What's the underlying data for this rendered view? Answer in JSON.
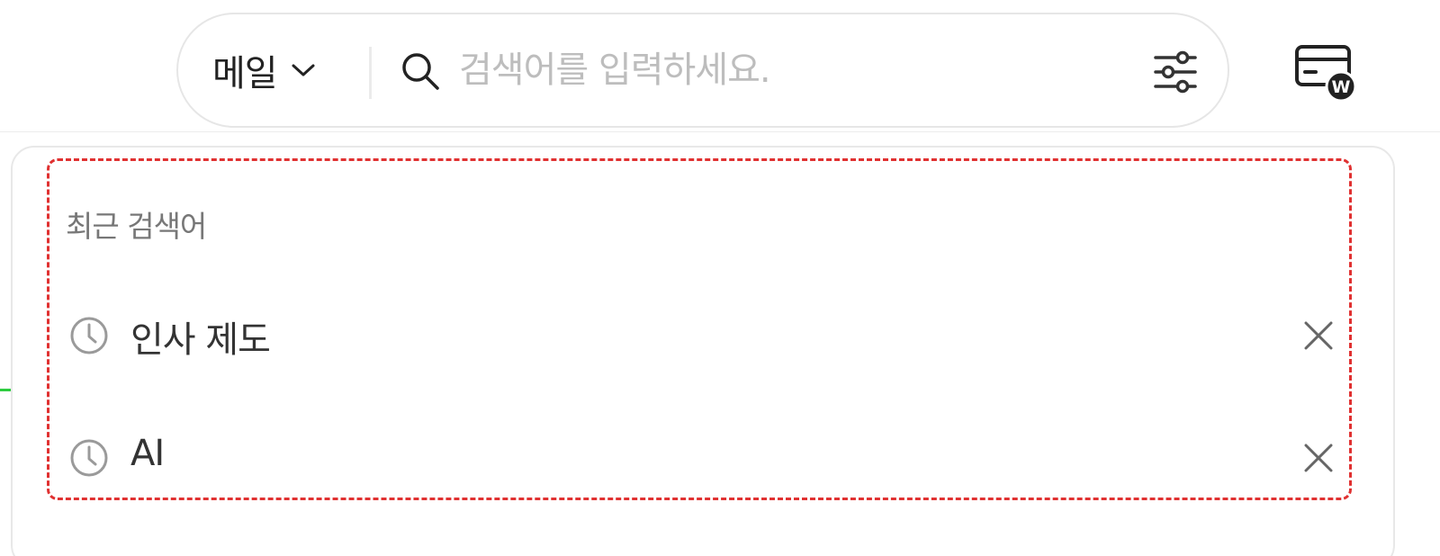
{
  "search": {
    "scope_label": "메일",
    "placeholder": "검색어를 입력하세요.",
    "value": ""
  },
  "recent": {
    "title": "최근 검색어",
    "items": [
      {
        "label": "인사 제도"
      },
      {
        "label": "AI"
      }
    ]
  },
  "icons": {
    "scope_dropdown": "chevron-down-icon",
    "search": "search-icon",
    "filter": "sliders-filter-icon",
    "wallet": "wallet-card-icon",
    "recent_item": "clock-icon",
    "remove_item": "close-icon"
  },
  "colors": {
    "highlight_border": "#e03131",
    "placeholder": "#bdbdbd",
    "section_title": "#777777",
    "text": "#333333"
  }
}
